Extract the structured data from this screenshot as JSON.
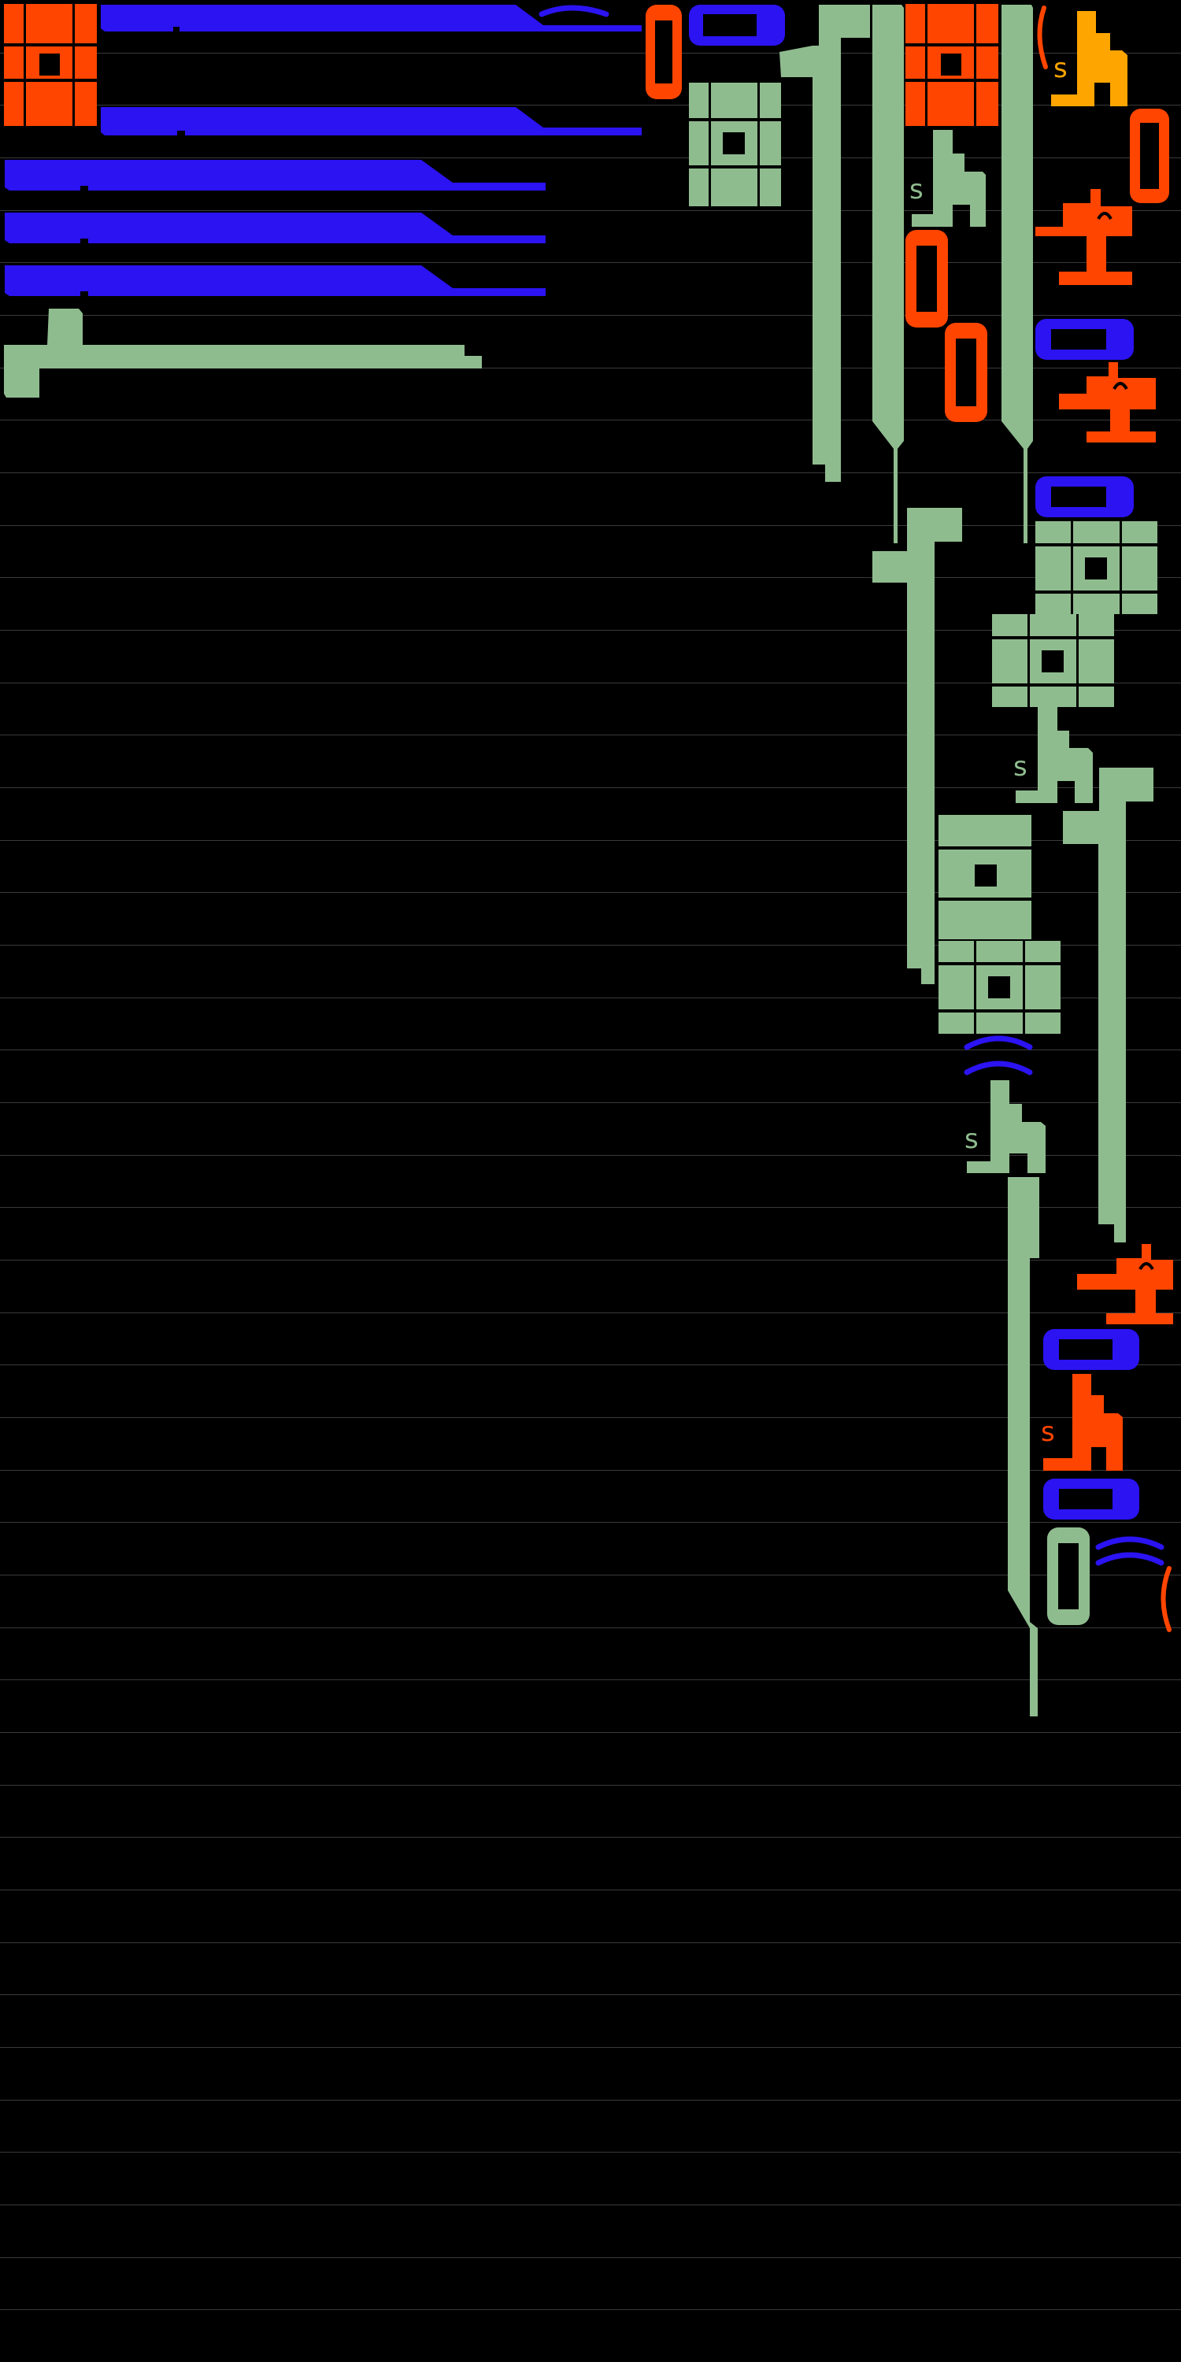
{
  "colors": {
    "background": "#000000",
    "gridline": "#3a3a3a",
    "sage": "#8fbc8f",
    "blue": "#2b13f2",
    "red": "#ff4500",
    "orange": "#ffa500"
  },
  "gridlines": {
    "count": 44
  },
  "glyph_kinds": [
    "double-square-block",
    "square-block",
    "sa-stack",
    "ta-stack",
    "pill-vertical",
    "pill-horizontal",
    "arc-stroke",
    "paren-stroke",
    "long-bar",
    "line-column"
  ]
}
